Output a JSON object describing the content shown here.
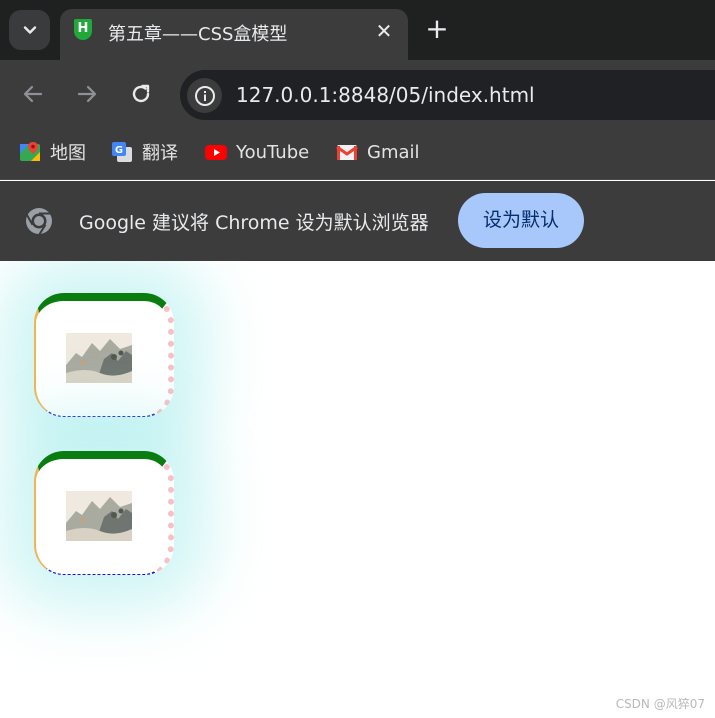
{
  "browser": {
    "tab": {
      "title": "第五章——CSS盒模型",
      "favicon_icon": "hbuilder-icon",
      "close_label": "✕"
    },
    "new_tab_label": "+",
    "toolbar": {
      "url": "127.0.0.1:8848/05/index.html"
    },
    "bookmarks": [
      {
        "label": "地图",
        "icon": "google-maps-icon"
      },
      {
        "label": "翻译",
        "icon": "google-translate-icon"
      },
      {
        "label": "YouTube",
        "icon": "youtube-icon"
      },
      {
        "label": "Gmail",
        "icon": "gmail-icon"
      }
    ],
    "infobar": {
      "message": "Google 建议将 Chrome 设为默认浏览器",
      "button_label": "设为默认"
    }
  },
  "page": {
    "boxes": [
      {
        "image": "landscape-painting-thumbnail"
      },
      {
        "image": "landscape-painting-thumbnail"
      }
    ],
    "watermark": "CSDN @风猝07"
  },
  "colors": {
    "box_border_top": "#0a7d10",
    "box_border_right": "#f8c0c5",
    "box_border_bottom": "#1414d8",
    "box_border_left": "#f0b455",
    "box_shadow": "#96e8e8",
    "infobar_button": "#a8c7fa"
  }
}
